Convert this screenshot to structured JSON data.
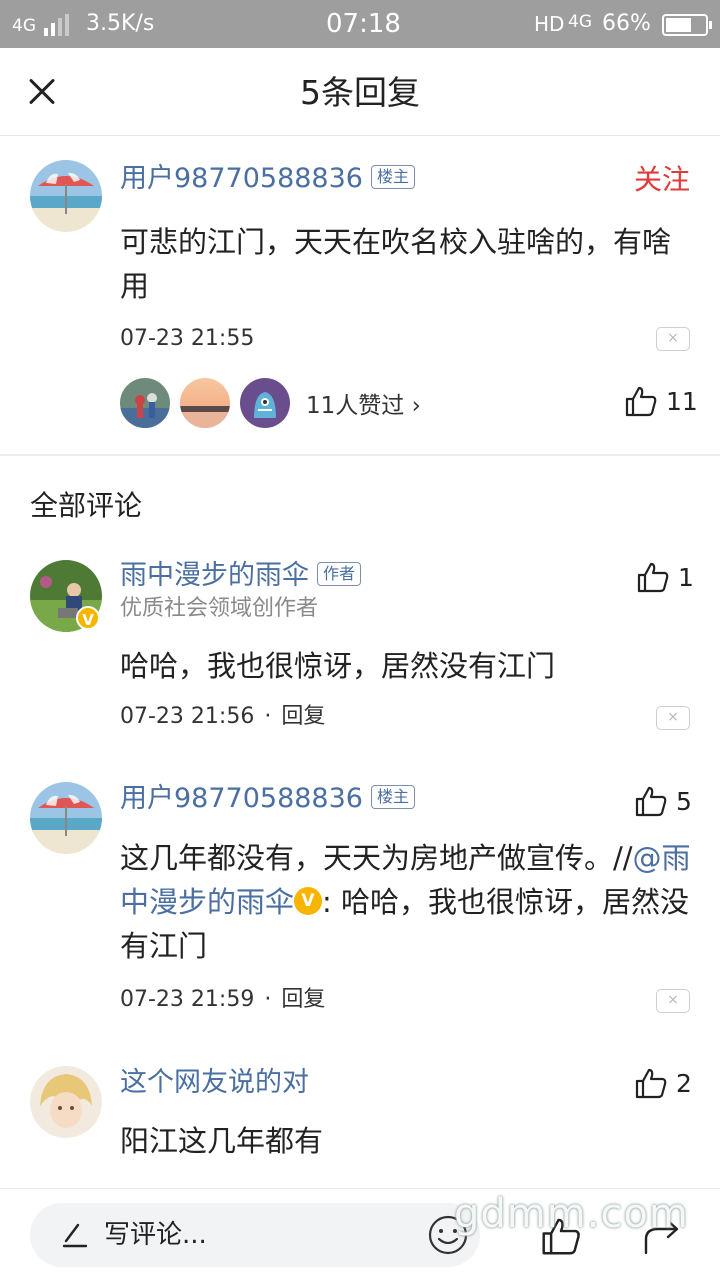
{
  "status_bar": {
    "network": "4G",
    "speed": "3.5K/s",
    "time": "07:18",
    "hd": "HD",
    "network_right": "4G",
    "battery": "66%",
    "battery_level": 0.66
  },
  "header": {
    "title": "5条回复"
  },
  "main_comment": {
    "username": "用户98770588836",
    "tag": "楼主",
    "follow_label": "关注",
    "text": "可悲的江门，天天在吹名校入驻啥的，有啥用",
    "time": "07-23 21:55",
    "likes_summary": "11人赞过 ›",
    "like_count": "11"
  },
  "section_title": "全部评论",
  "replies": [
    {
      "username": "雨中漫步的雨伞",
      "tag": "作者",
      "subtitle": "优质社会领域创作者",
      "verified_mark": "V",
      "text": "哈哈，我也很惊讶，居然没有江门",
      "time": "07-23 21:56",
      "reply_label": "回复",
      "like_count": "1"
    },
    {
      "username": "用户98770588836",
      "tag": "楼主",
      "text_main": "这几年都没有，天天为房地产做宣传。//",
      "mention": "@雨中漫步的雨伞",
      "mention_mark": "V",
      "text_quote": ": 哈哈，我也很惊讶，居然没有江门",
      "time": "07-23 21:59",
      "reply_label": "回复",
      "like_count": "5"
    },
    {
      "username": "这个网友说的对",
      "text": "阳江这几年都有",
      "like_count": "2"
    }
  ],
  "report_label": "×",
  "meta_separator": "·",
  "bottom_bar": {
    "comment_placeholder": "写评论..."
  },
  "watermark": "gdmm.com",
  "colors": {
    "link_blue": "#4a6fa0",
    "follow_red": "#e03a3a",
    "verified_yellow": "#f7b500",
    "status_bar_gray": "#9e9e9e"
  }
}
